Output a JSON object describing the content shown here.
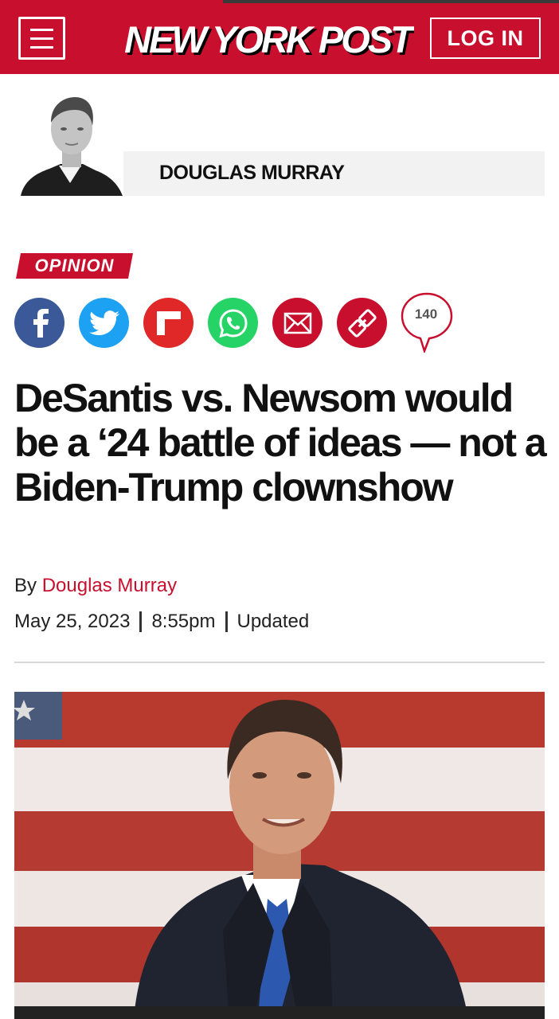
{
  "header": {
    "logo_text": "NEW YORK POST",
    "login_label": "LOG IN",
    "brand_color": "#c8102e",
    "menu_icon": "hamburger-menu-icon"
  },
  "author": {
    "name": "DOUGLAS MURRAY"
  },
  "section": {
    "label": "OPINION"
  },
  "share": {
    "items": [
      {
        "name": "facebook",
        "icon": "facebook-icon",
        "color": "#3b5998"
      },
      {
        "name": "twitter",
        "icon": "twitter-icon",
        "color": "#1da1f2"
      },
      {
        "name": "flipboard",
        "icon": "flipboard-icon",
        "color": "#e12828"
      },
      {
        "name": "whatsapp",
        "icon": "whatsapp-icon",
        "color": "#25d366"
      },
      {
        "name": "email",
        "icon": "email-icon",
        "color": "#c8102e"
      },
      {
        "name": "copy-link",
        "icon": "link-icon",
        "color": "#c8102e"
      }
    ],
    "comment_count": "140"
  },
  "article": {
    "headline": "DeSantis vs. Newsom would be a ‘24 battle of ideas — not a Biden-Trump clownshow",
    "byline_prefix": "By",
    "byline_author": "Douglas Murray",
    "date": "May 25, 2023",
    "time": "8:55pm",
    "updated_label": "Updated"
  }
}
